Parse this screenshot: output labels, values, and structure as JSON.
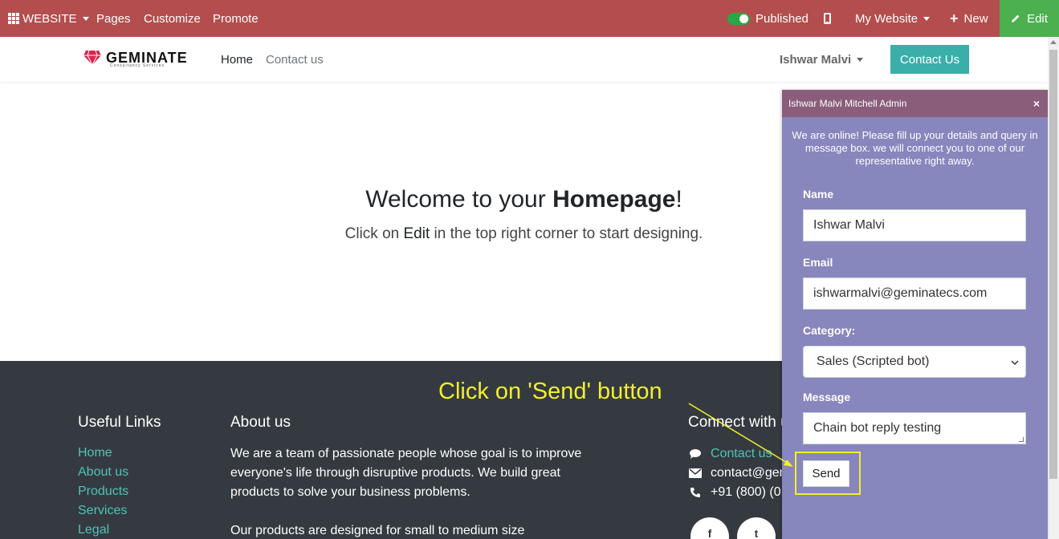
{
  "admin_bar": {
    "website_menu": "WEBSITE",
    "pages": "Pages",
    "customize": "Customize",
    "promote": "Promote",
    "published": "Published",
    "my_website": "My Website",
    "new": "New",
    "edit": "Edit"
  },
  "header": {
    "logo_text": "GEMINATE",
    "logo_tagline": "Consultancy Services",
    "nav": [
      "Home",
      "Contact us"
    ],
    "user": "Ishwar Malvi",
    "contact_button": "Contact Us"
  },
  "hero": {
    "title_pre": "Welcome to your ",
    "title_bold": "Homepage",
    "title_post": "!",
    "sub_pre": "Click on ",
    "sub_bold": "Edit",
    "sub_post": " in the top right corner to start designing."
  },
  "footer": {
    "useful_links_heading": "Useful Links",
    "links": [
      "Home",
      "About us",
      "Products",
      "Services",
      "Legal"
    ],
    "about_heading": "About us",
    "about_p1": "We are a team of passionate people whose goal is to improve everyone's life through disruptive products. We build great products to solve your business problems.",
    "about_p2": "Our products are designed for small to medium size",
    "connect_heading": "Connect with u",
    "contact_link": "Contact us",
    "email": "contact@gem",
    "phone": "+91 (800) (0",
    "social_fb": "f",
    "social_tw": "t"
  },
  "chat": {
    "title": "Ishwar Malvi Mitchell Admin",
    "close": "×",
    "intro": "We are online! Please fill up your details and query in message box. we will connect you to one of our representative right away.",
    "name_label": "Name",
    "name_value": "Ishwar Malvi",
    "email_label": "Email",
    "email_value": "ishwarmalvi@geminatecs.com",
    "category_label": "Category:",
    "category_value": "Sales (Scripted bot)",
    "message_label": "Message",
    "message_value": "Chain bot reply testing",
    "send": "Send"
  },
  "annotation": {
    "text": "Click on 'Send' button",
    "color": "#f2ef2f"
  },
  "colors": {
    "admin_bar": "#b44d4d",
    "edit_button": "#4caf50",
    "contact_button": "#3aafa9",
    "footer": "#353a40",
    "chat_body": "#8786bd",
    "chat_header": "#8a5d7b",
    "link": "#4fc3b9"
  }
}
